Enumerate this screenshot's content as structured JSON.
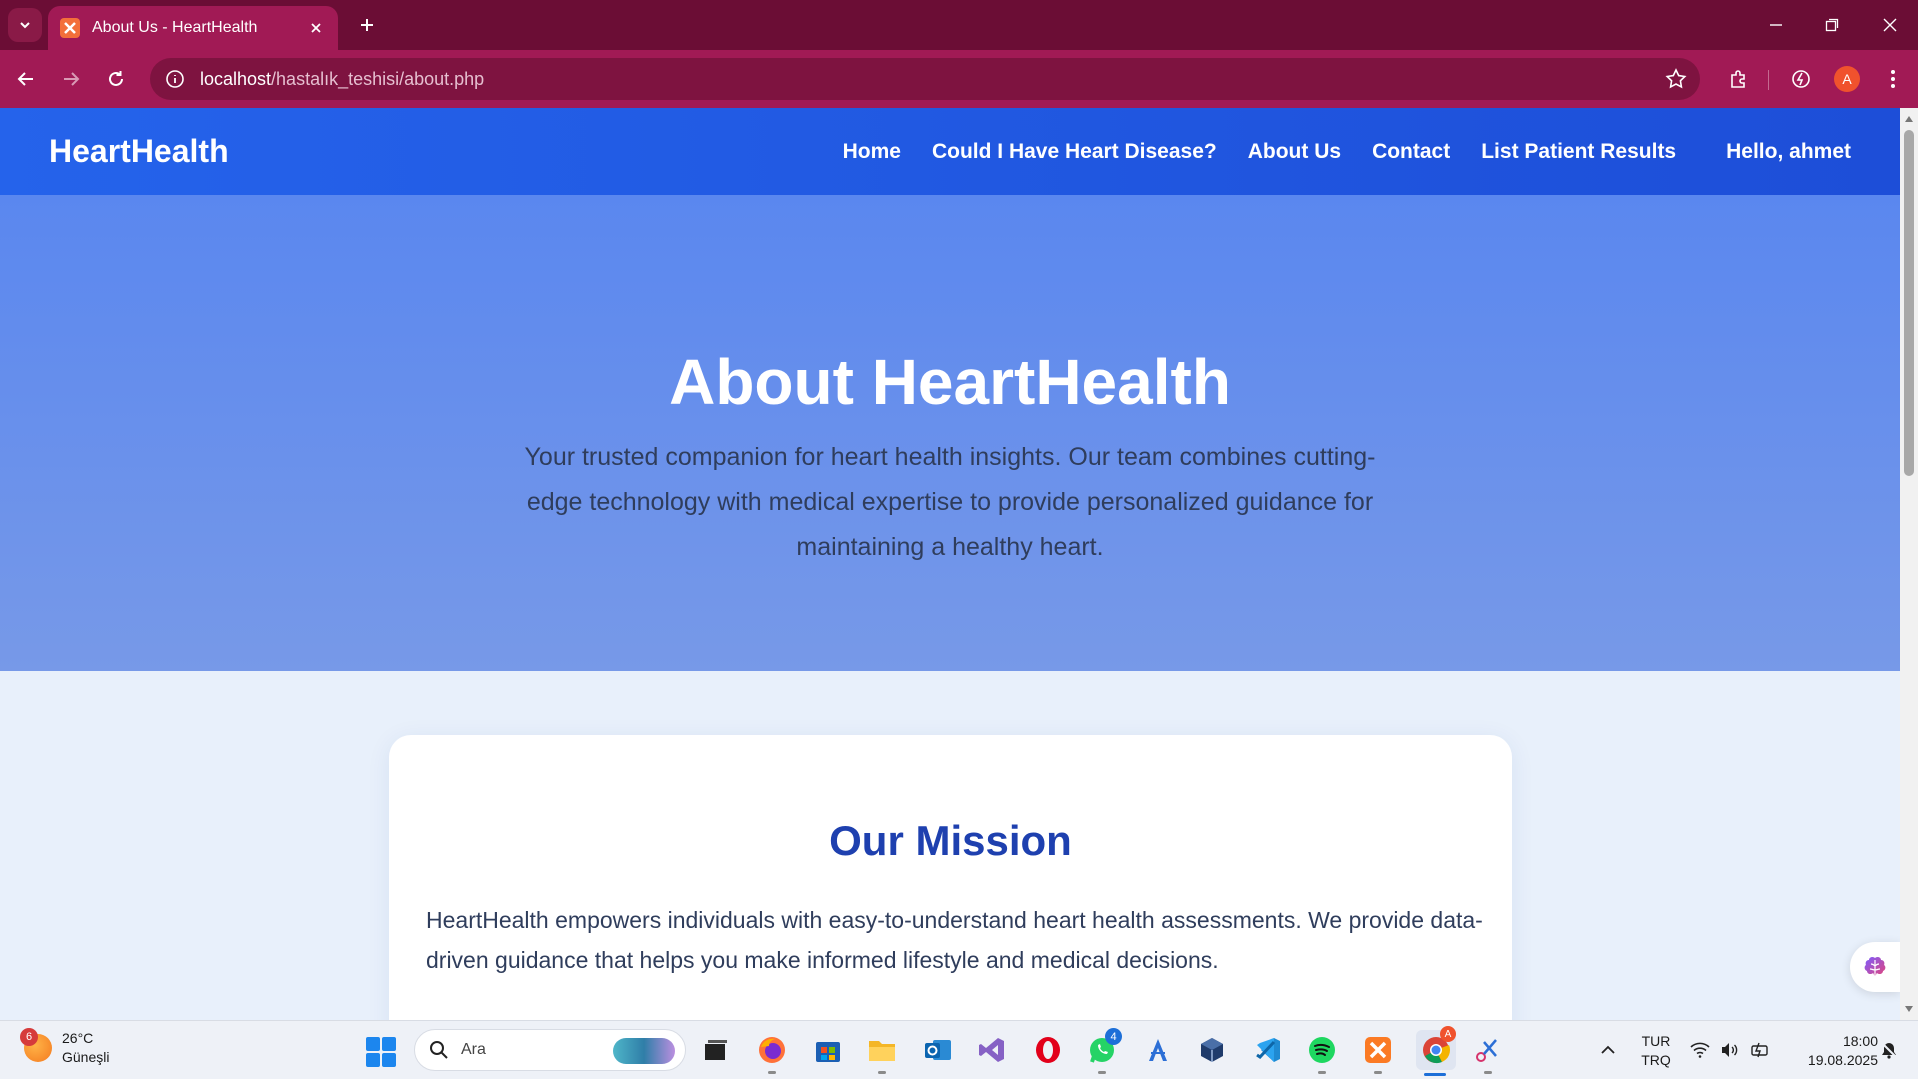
{
  "browser": {
    "tab_title": "About Us - HeartHealth",
    "url_host": "localhost",
    "url_path": "/hastalık_teshisi/about.php",
    "profile_initial": "A"
  },
  "navbar": {
    "brand": "HeartHealth",
    "links": [
      "Home",
      "Could I Have Heart Disease?",
      "About Us",
      "Contact",
      "List Patient Results"
    ],
    "user_greeting": "Hello, ahmet"
  },
  "hero": {
    "title": "About HeartHealth",
    "description": "Your trusted companion for heart health insights. Our team combines cutting-edge technology with medical expertise to provide personalized guidance for maintaining a healthy heart."
  },
  "mission": {
    "title": "Our Mission",
    "body": "HeartHealth empowers individuals with easy-to-understand heart health assessments. We provide data-driven guidance that helps you make informed lifestyle and medical decisions."
  },
  "taskbar": {
    "weather_badge": "6",
    "temperature": "26°C",
    "weather_condition": "Güneşli",
    "search_placeholder": "Ara",
    "whatsapp_badge": "4",
    "chrome_badge": "A",
    "language_line1": "TUR",
    "language_line2": "TRQ",
    "time": "18:00",
    "date": "19.08.2025"
  },
  "colors": {
    "tab_strip": "#6b0d35",
    "toolbar": "#a11a55",
    "navbar": "#2563eb",
    "hero_top": "#5a87ef",
    "mission_title": "#1e40af"
  }
}
